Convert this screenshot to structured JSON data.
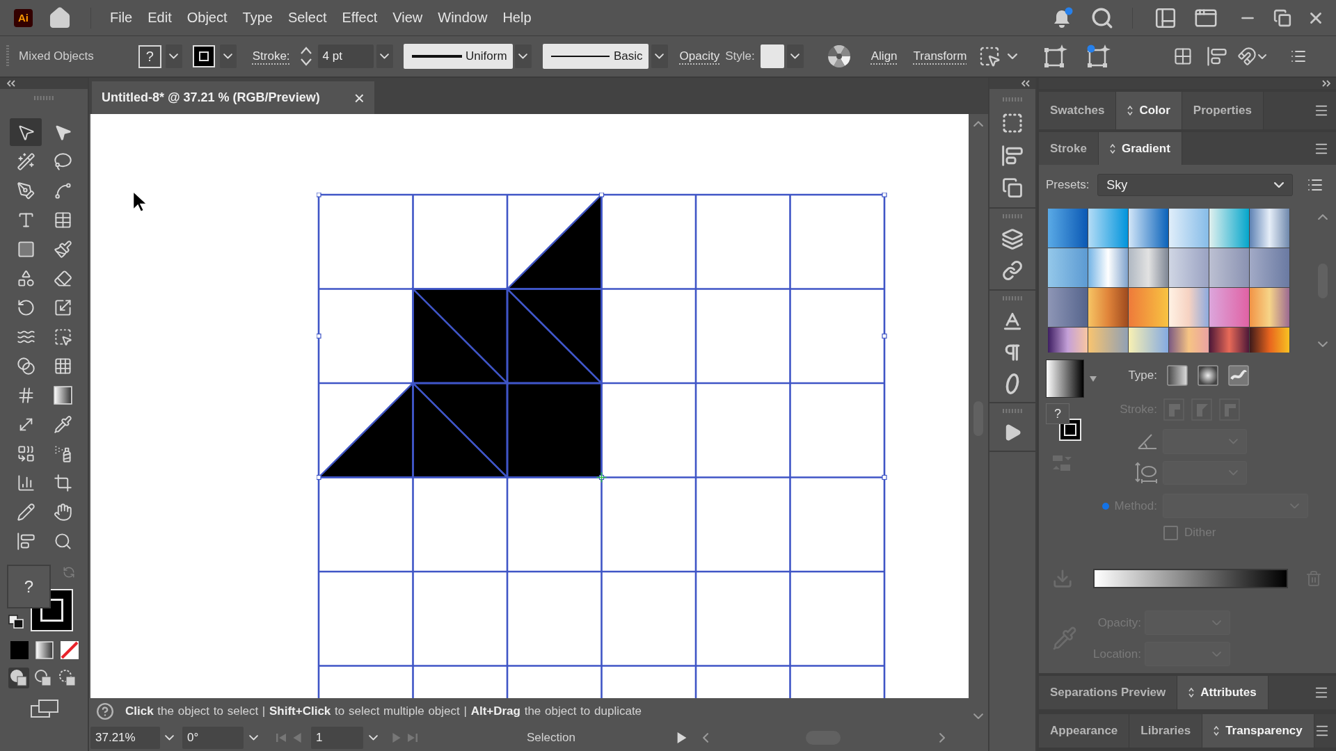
{
  "menu_bar": {
    "logo": "Ai",
    "items": [
      "File",
      "Edit",
      "Object",
      "Type",
      "Select",
      "Effect",
      "View",
      "Window",
      "Help"
    ]
  },
  "control_bar": {
    "selection": "Mixed Objects",
    "fill": "?",
    "stroke_label": "Stroke:",
    "stroke_weight": "4 pt",
    "profile": "Uniform",
    "brush": "Basic",
    "opacity": "Opacity",
    "style_label": "Style:",
    "align": "Align",
    "transform": "Transform"
  },
  "document_tab": {
    "title": "Untitled-8* @ 37.21 % (RGB/Preview)",
    "close": "×"
  },
  "toolbar": {
    "tools": [
      {
        "kind": "selection",
        "selected": true
      },
      {
        "kind": "direct_selection",
        "selected": false
      },
      {
        "kind": "magic_wand",
        "selected": false
      },
      {
        "kind": "lasso",
        "selected": false
      },
      {
        "kind": "pen",
        "selected": false
      },
      {
        "kind": "curvature",
        "selected": false
      },
      {
        "kind": "type",
        "selected": false
      },
      {
        "kind": "grid",
        "selected": false
      },
      {
        "kind": "rectangle",
        "selected": false
      },
      {
        "kind": "paintbrush",
        "selected": false
      },
      {
        "kind": "shaper",
        "selected": false
      },
      {
        "kind": "eraser",
        "selected": false
      },
      {
        "kind": "rotate",
        "selected": false
      },
      {
        "kind": "scale",
        "selected": false
      },
      {
        "kind": "warp",
        "selected": false
      },
      {
        "kind": "free_transform",
        "selected": false
      },
      {
        "kind": "shape_builder",
        "selected": false
      },
      {
        "kind": "perspective",
        "selected": false
      },
      {
        "kind": "mesh",
        "selected": false
      },
      {
        "kind": "gradient",
        "selected": false
      },
      {
        "kind": "width",
        "selected": false
      },
      {
        "kind": "eyedropper",
        "selected": false
      },
      {
        "kind": "blend",
        "selected": false
      },
      {
        "kind": "symbol_sprayer",
        "selected": false
      },
      {
        "kind": "column_graph",
        "selected": false
      },
      {
        "kind": "artboard",
        "selected": false
      },
      {
        "kind": "pencil",
        "selected": false
      },
      {
        "kind": "hand",
        "selected": false
      },
      {
        "kind": "align",
        "selected": false
      },
      {
        "kind": "zoom",
        "selected": false
      }
    ],
    "fill": "?",
    "draw_modes": [
      {
        "kind": "normal",
        "selected": true
      },
      {
        "kind": "behind",
        "selected": false
      },
      {
        "kind": "inside",
        "selected": false
      }
    ]
  },
  "color_tabs": [
    {
      "label": "Swatches",
      "selected": false
    },
    {
      "label": "Color",
      "selected": true
    },
    {
      "label": "Properties",
      "selected": false
    }
  ],
  "gradient_panel": {
    "tabs": [
      {
        "label": "Stroke",
        "selected": false
      },
      {
        "label": "Gradient",
        "selected": true
      }
    ],
    "presets_label": "Presets:",
    "preset": "Sky",
    "fill": "?",
    "type_label": "Type:",
    "stroke": {
      "label": "Stroke:",
      "disabled": true
    },
    "angle": {
      "disabled": true
    },
    "aspect_ratio": {
      "disabled": true
    },
    "method": {
      "label": "Method:",
      "disabled": true
    },
    "dither": {
      "label": "Dither",
      "checked": false,
      "disabled": true
    },
    "opacity": {
      "label": "Opacity:",
      "disabled": true
    },
    "location": {
      "label": "Location:",
      "disabled": true
    }
  },
  "attributes_tabs": [
    {
      "label": "Separations Preview",
      "selected": false
    },
    {
      "label": "Attributes",
      "selected": true
    }
  ],
  "transparency_tabs": [
    {
      "label": "Appearance",
      "selected": false
    },
    {
      "label": "Libraries",
      "selected": false
    },
    {
      "label": "Transparency",
      "selected": true
    }
  ],
  "hint": "**Click** the object to select | **Shift+Click** to select multiple object | **Alt+Drag** the object to duplicate",
  "status_bar": {
    "zoom": "37.21%",
    "rotation": "0°",
    "artboard": "1",
    "tool": "Selection"
  }
}
